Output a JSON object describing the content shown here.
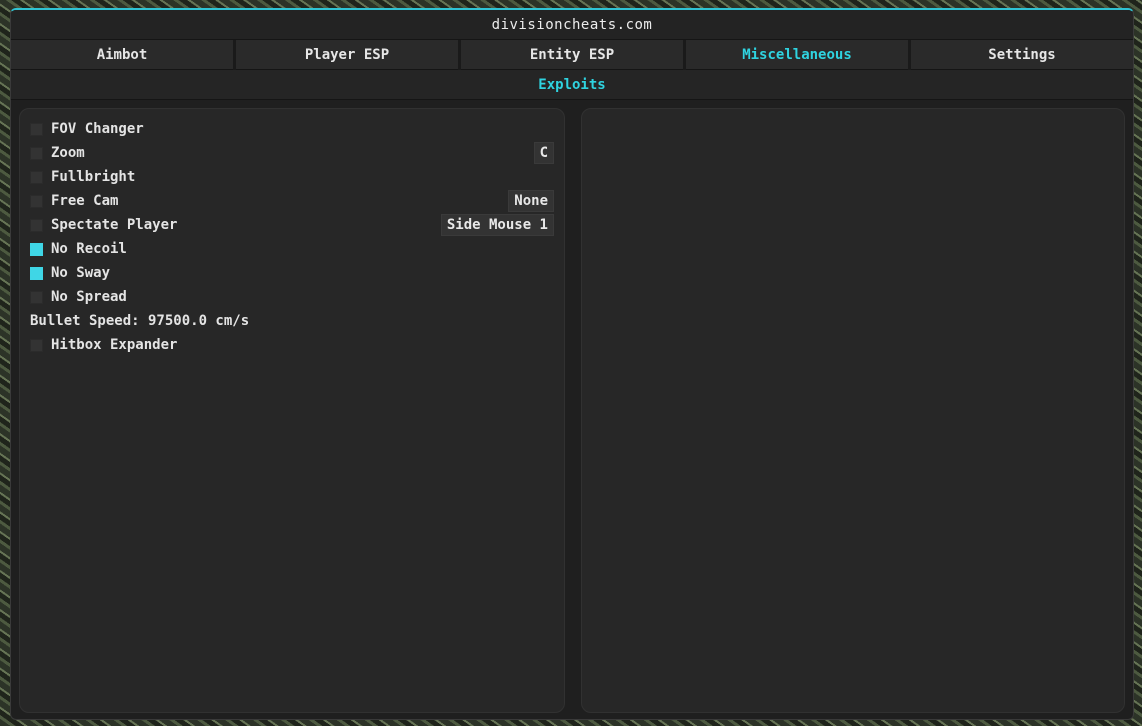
{
  "window": {
    "title": "divisioncheats.com",
    "accent_color": "#2fd3e0"
  },
  "tabs": [
    {
      "label": "Aimbot",
      "active": false
    },
    {
      "label": "Player ESP",
      "active": false
    },
    {
      "label": "Entity ESP",
      "active": false
    },
    {
      "label": "Miscellaneous",
      "active": true
    },
    {
      "label": "Settings",
      "active": false
    }
  ],
  "section": {
    "title": "Exploits"
  },
  "options": {
    "fov_changer": {
      "label": "FOV Changer",
      "checked": false
    },
    "zoom": {
      "label": "Zoom",
      "checked": false,
      "key": "C"
    },
    "fullbright": {
      "label": "Fullbright",
      "checked": false
    },
    "free_cam": {
      "label": "Free Cam",
      "checked": false,
      "key": "None"
    },
    "spectate_player": {
      "label": "Spectate Player",
      "checked": false,
      "key": "Side Mouse 1"
    },
    "no_recoil": {
      "label": "No Recoil",
      "checked": true
    },
    "no_sway": {
      "label": "No Sway",
      "checked": true
    },
    "no_spread": {
      "label": "No Spread",
      "checked": false
    },
    "bullet_speed": {
      "text": "Bullet Speed: 97500.0 cm/s"
    },
    "hitbox_expander": {
      "label": "Hitbox Expander",
      "checked": false
    }
  }
}
